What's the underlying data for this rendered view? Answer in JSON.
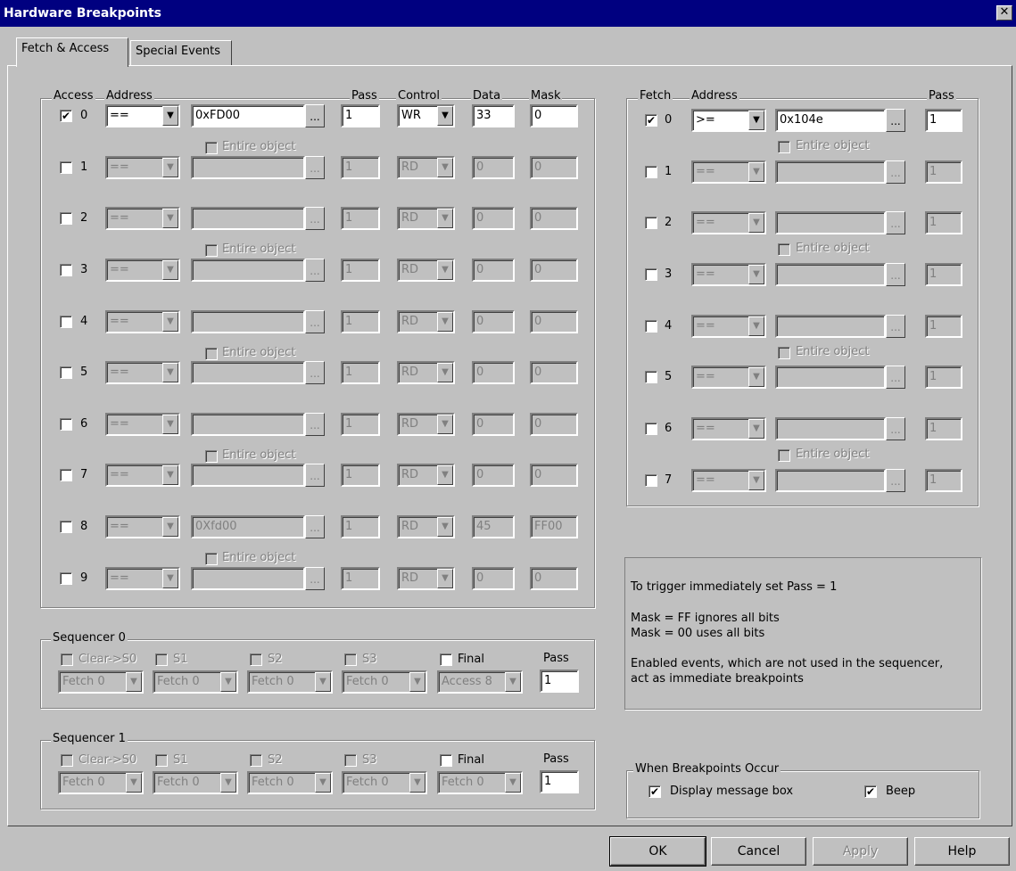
{
  "window": {
    "title": "Hardware Breakpoints"
  },
  "tabs": [
    {
      "label": "Fetch & Access"
    },
    {
      "label": "Special Events"
    }
  ],
  "access": {
    "headers": {
      "access": "Access",
      "address": "Address",
      "pass": "Pass",
      "control": "Control",
      "data": "Data",
      "mask": "Mask"
    },
    "rows": [
      {
        "idx": "0",
        "checked": true,
        "enabled": true,
        "op": "==",
        "address": "0xFD00",
        "pass": "1",
        "control": "WR",
        "data": "33",
        "mask": "0"
      },
      {
        "idx": "1",
        "checked": false,
        "enabled": false,
        "op": "==",
        "address": "",
        "pass": "1",
        "control": "RD",
        "data": "0",
        "mask": "0"
      },
      {
        "idx": "2",
        "checked": false,
        "enabled": false,
        "op": "==",
        "address": "",
        "pass": "1",
        "control": "RD",
        "data": "0",
        "mask": "0"
      },
      {
        "idx": "3",
        "checked": false,
        "enabled": false,
        "op": "==",
        "address": "",
        "pass": "1",
        "control": "RD",
        "data": "0",
        "mask": "0"
      },
      {
        "idx": "4",
        "checked": false,
        "enabled": false,
        "op": "==",
        "address": "",
        "pass": "1",
        "control": "RD",
        "data": "0",
        "mask": "0"
      },
      {
        "idx": "5",
        "checked": false,
        "enabled": false,
        "op": "==",
        "address": "",
        "pass": "1",
        "control": "RD",
        "data": "0",
        "mask": "0"
      },
      {
        "idx": "6",
        "checked": false,
        "enabled": false,
        "op": "==",
        "address": "",
        "pass": "1",
        "control": "RD",
        "data": "0",
        "mask": "0"
      },
      {
        "idx": "7",
        "checked": false,
        "enabled": false,
        "op": "==",
        "address": "",
        "pass": "1",
        "control": "RD",
        "data": "0",
        "mask": "0"
      },
      {
        "idx": "8",
        "checked": false,
        "enabled": false,
        "op": "==",
        "address": "0Xfd00",
        "pass": "1",
        "control": "RD",
        "data": "45",
        "mask": "FF00"
      },
      {
        "idx": "9",
        "checked": false,
        "enabled": false,
        "op": "==",
        "address": "",
        "pass": "1",
        "control": "RD",
        "data": "0",
        "mask": "0"
      }
    ],
    "entire_object_label": "Entire object"
  },
  "fetch": {
    "headers": {
      "fetch": "Fetch",
      "address": "Address",
      "pass": "Pass"
    },
    "rows": [
      {
        "idx": "0",
        "checked": true,
        "enabled": true,
        "op": ">=",
        "address": "0x104e",
        "pass": "1"
      },
      {
        "idx": "1",
        "checked": false,
        "enabled": false,
        "op": "==",
        "address": "",
        "pass": "1"
      },
      {
        "idx": "2",
        "checked": false,
        "enabled": false,
        "op": "==",
        "address": "",
        "pass": "1"
      },
      {
        "idx": "3",
        "checked": false,
        "enabled": false,
        "op": "==",
        "address": "",
        "pass": "1"
      },
      {
        "idx": "4",
        "checked": false,
        "enabled": false,
        "op": "==",
        "address": "",
        "pass": "1"
      },
      {
        "idx": "5",
        "checked": false,
        "enabled": false,
        "op": "==",
        "address": "",
        "pass": "1"
      },
      {
        "idx": "6",
        "checked": false,
        "enabled": false,
        "op": "==",
        "address": "",
        "pass": "1"
      },
      {
        "idx": "7",
        "checked": false,
        "enabled": false,
        "op": "==",
        "address": "",
        "pass": "1"
      }
    ],
    "entire_object_label": "Entire object"
  },
  "sequencers": [
    {
      "title": "Sequencer 0",
      "stages": [
        {
          "label": "Clear->S0",
          "select": "Fetch 0"
        },
        {
          "label": "S1",
          "select": "Fetch 0"
        },
        {
          "label": "S2",
          "select": "Fetch 0"
        },
        {
          "label": "S3",
          "select": "Fetch 0"
        },
        {
          "label": "Final",
          "select": "Access 8"
        }
      ],
      "pass_label": "Pass",
      "pass": "1"
    },
    {
      "title": "Sequencer 1",
      "stages": [
        {
          "label": "Clear->S0",
          "select": "Fetch 0"
        },
        {
          "label": "S1",
          "select": "Fetch 0"
        },
        {
          "label": "S2",
          "select": "Fetch 0"
        },
        {
          "label": "S3",
          "select": "Fetch 0"
        },
        {
          "label": "Final",
          "select": "Fetch 0"
        }
      ],
      "pass_label": "Pass",
      "pass": "1"
    }
  ],
  "info": {
    "line1": "To trigger immediately set Pass = 1",
    "line2": "Mask = FF ignores all bits",
    "line3": "Mask = 00 uses all bits",
    "line4": "Enabled events, which are not used in the sequencer,",
    "line5": "act as immediate breakpoints"
  },
  "when": {
    "title": "When Breakpoints Occur",
    "display_msg": "Display message box",
    "beep": "Beep"
  },
  "buttons": {
    "ok": "OK",
    "cancel": "Cancel",
    "apply": "Apply",
    "help": "Help"
  }
}
